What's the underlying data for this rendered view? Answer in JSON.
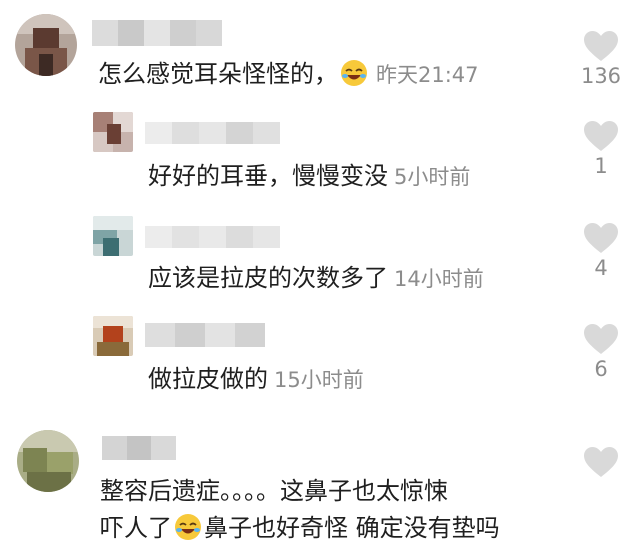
{
  "comments": [
    {
      "username_blurred": true,
      "text": "怎么感觉耳朵怪怪的，",
      "emoji": "rofl-emoji",
      "time": "昨天21:47",
      "likes": "136"
    },
    {
      "username_blurred": true,
      "text": "好好的耳垂，慢慢变没",
      "time": "5小时前",
      "likes": "1"
    },
    {
      "username_blurred": true,
      "text": "应该是拉皮的次数多了",
      "time": "14小时前",
      "likes": "4"
    },
    {
      "username_blurred": true,
      "text": "做拉皮做的",
      "time": "15小时前",
      "likes": "6"
    },
    {
      "username_blurred": true,
      "text_line1": "整容后遗症。。。。这鼻子也太惊悚",
      "text_line2_a": "吓人了",
      "emoji": "rofl-emoji",
      "text_line2_b": "鼻子也好奇怪 确定没有垫吗",
      "likes": ""
    }
  ],
  "colors": {
    "like_icon": "#d9d9d9",
    "meta_text": "#8c8c8c",
    "body_text": "#1f1f1f"
  },
  "icons": {
    "like": "heart-icon",
    "emoji": "rofl-emoji-icon"
  }
}
